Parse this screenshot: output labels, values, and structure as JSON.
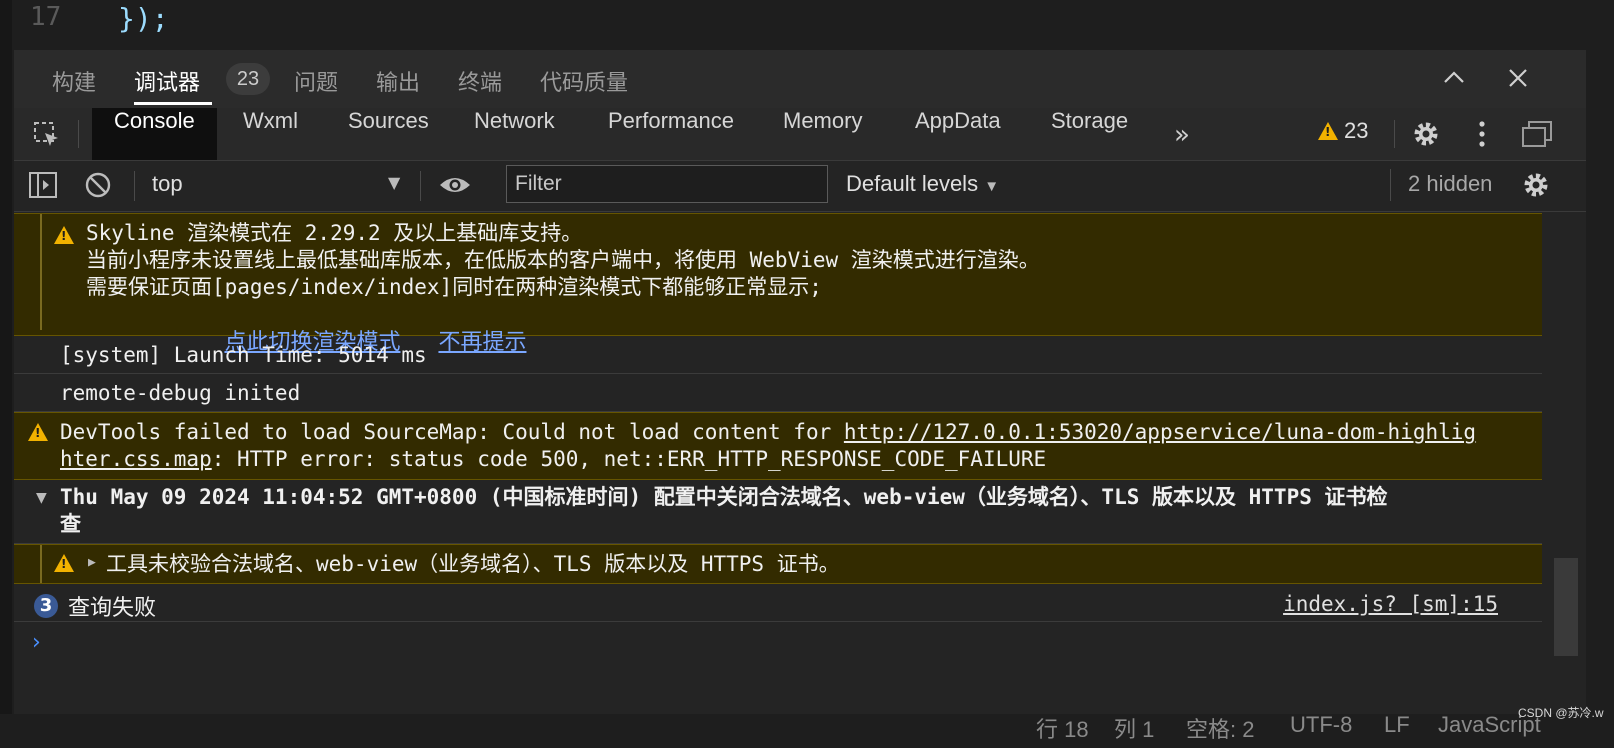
{
  "editor": {
    "line_number": "17",
    "code": "});"
  },
  "panel_tabs": {
    "items": [
      "构建",
      "调试器",
      "问题",
      "输出",
      "终端",
      "代码质量"
    ],
    "debugger_badge": "23"
  },
  "devtools_tabs": {
    "items": [
      "Console",
      "Wxml",
      "Sources",
      "Network",
      "Performance",
      "Memory",
      "AppData",
      "Storage"
    ],
    "warning_count": "23"
  },
  "toolbar": {
    "context": "top",
    "filter_placeholder": "Filter",
    "levels": "Default levels",
    "hidden": "2 hidden"
  },
  "messages": {
    "skyline_l1": "Skyline 渲染模式在 2.29.2 及以上基础库支持。",
    "skyline_l2": "当前小程序未设置线上最低基础库版本，在低版本的客户端中，将使用 WebView 渲染模式进行渲染。",
    "skyline_l3": "需要保证页面[pages/index/index]同时在两种渲染模式下都能够正常显示;",
    "skyline_link_switch": "点此切换渲染模式",
    "skyline_link_dismiss": "不再提示",
    "launch": "[system] Launch Time: 5014 ms",
    "remote": "remote-debug inited",
    "sourcemap_prefix": "DevTools failed to load SourceMap: Could not load content for ",
    "sourcemap_url_1": "http://127.0.0.1:53020/appservice/luna-dom-highlig",
    "sourcemap_url_2": "hter.css.map",
    "sourcemap_suffix": ": HTTP error: status code 500, net::ERR_HTTP_RESPONSE_CODE_FAILURE",
    "group_l1": "Thu May 09 2024 11:04:52 GMT+0800 (中国标准时间) 配置中关闭合法域名、web-view（业务域名）、TLS 版本以及 HTTPS 证书检",
    "group_l2": "查",
    "group_child": "工具未校验合法域名、web-view（业务域名）、TLS 版本以及 HTTPS 证书。",
    "query_count": "3",
    "query_text": "查询失败",
    "query_source": "index.js? [sm]:15"
  },
  "status_bar": {
    "line": "行 18",
    "col": "列 1",
    "spaces": "空格: 2",
    "encoding": "UTF-8",
    "eol": "LF",
    "language": "JavaScript"
  },
  "watermark": "CSDN @苏冷.w",
  "colors": {
    "warning": "#f2b200",
    "link": "#7aa7ff",
    "prompt": "#4a90ff"
  }
}
